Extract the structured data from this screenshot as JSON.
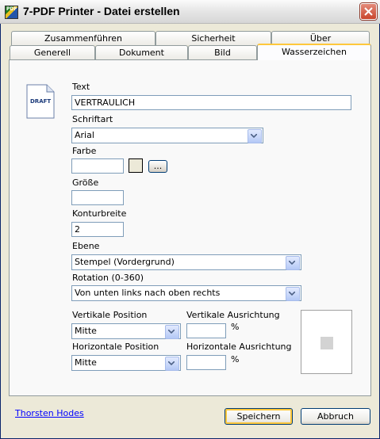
{
  "window": {
    "title": "7-PDF Printer - Datei erstellen",
    "icon": "pdf-printer-app-icon",
    "icon_text": "PDF"
  },
  "tabs": {
    "row_back": [
      "Zusammenführen",
      "Sicherheit",
      "Über"
    ],
    "row_front": [
      "Generell",
      "Dokument",
      "Bild",
      "Wasserzeichen"
    ],
    "active": "Wasserzeichen"
  },
  "watermark": {
    "doc_icon_text": "DRAFT",
    "text_label": "Text",
    "text_value": "VERTRAULICH",
    "font_label": "Schriftart",
    "font_value": "Arial",
    "color_label": "Farbe",
    "color_value": "",
    "color_button": "...",
    "size_label": "Größe",
    "size_value": "",
    "outline_label": "Konturbreite",
    "outline_value": "2",
    "layer_label": "Ebene",
    "layer_value": "Stempel (Vordergrund)",
    "rotation_label": "Rotation (0-360)",
    "rotation_value": "Von unten links nach oben rechts",
    "vpos_label": "Vertikale Position",
    "vpos_value": "Mitte",
    "valign_label": "Vertikale Ausrichtung",
    "valign_value": "",
    "hpos_label": "Horizontale Position",
    "hpos_value": "Mitte",
    "halign_label": "Horizontale Ausrichtung",
    "halign_value": "",
    "percent": "%"
  },
  "footer": {
    "link": "Thorsten Hodes",
    "save": "Speichern",
    "cancel": "Abbruch"
  },
  "colors": {
    "titlebar": "#E7E7E7",
    "close": "#C9452C",
    "active_tab_accent": "#FFC83C",
    "link": "#0000FF",
    "input_border": "#7F9DB9"
  }
}
